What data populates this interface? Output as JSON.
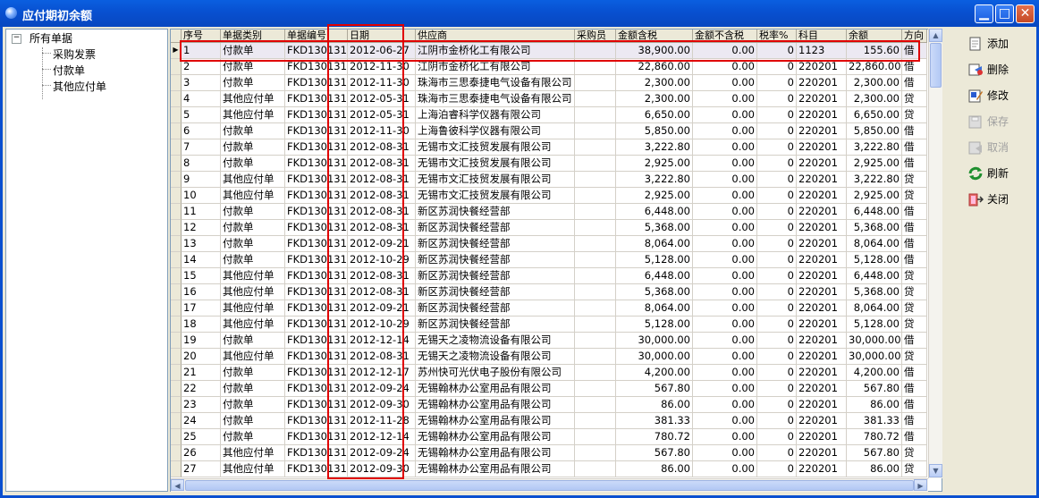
{
  "window": {
    "title": "应付期初余额"
  },
  "tree": {
    "root": "所有单据",
    "children": [
      "采购发票",
      "付款单",
      "其他应付单"
    ]
  },
  "table": {
    "columns": [
      "序号",
      "单据类别",
      "单据编号",
      "日期",
      "供应商",
      "采购员",
      "金额含税",
      "金额不含税",
      "税率%",
      "科目",
      "余额",
      "方向"
    ],
    "rows": [
      [
        "1",
        "付款单",
        "FKD130131",
        "2012-06-27",
        "江阴市金桥化工有限公司",
        "",
        "38,900.00",
        "0.00",
        "0",
        "1123",
        "155.60",
        "借"
      ],
      [
        "2",
        "付款单",
        "FKD130131",
        "2012-11-30",
        "江阴市金桥化工有限公司",
        "",
        "22,860.00",
        "0.00",
        "0",
        "220201",
        "22,860.00",
        "借"
      ],
      [
        "3",
        "付款单",
        "FKD130131",
        "2012-11-30",
        "珠海市三思泰捷电气设备有限公司",
        "",
        "2,300.00",
        "0.00",
        "0",
        "220201",
        "2,300.00",
        "借"
      ],
      [
        "4",
        "其他应付单",
        "FKD130131",
        "2012-05-31",
        "珠海市三思泰捷电气设备有限公司",
        "",
        "2,300.00",
        "0.00",
        "0",
        "220201",
        "2,300.00",
        "贷"
      ],
      [
        "5",
        "其他应付单",
        "FKD130131",
        "2012-05-31",
        "上海泊睿科学仪器有限公司",
        "",
        "6,650.00",
        "0.00",
        "0",
        "220201",
        "6,650.00",
        "贷"
      ],
      [
        "6",
        "付款单",
        "FKD130131",
        "2012-11-30",
        "上海鲁彼科学仪器有限公司",
        "",
        "5,850.00",
        "0.00",
        "0",
        "220201",
        "5,850.00",
        "借"
      ],
      [
        "7",
        "付款单",
        "FKD130131",
        "2012-08-31",
        "无锡市文汇技贸发展有限公司",
        "",
        "3,222.80",
        "0.00",
        "0",
        "220201",
        "3,222.80",
        "借"
      ],
      [
        "8",
        "付款单",
        "FKD130131",
        "2012-08-31",
        "无锡市文汇技贸发展有限公司",
        "",
        "2,925.00",
        "0.00",
        "0",
        "220201",
        "2,925.00",
        "借"
      ],
      [
        "9",
        "其他应付单",
        "FKD130131",
        "2012-08-31",
        "无锡市文汇技贸发展有限公司",
        "",
        "3,222.80",
        "0.00",
        "0",
        "220201",
        "3,222.80",
        "贷"
      ],
      [
        "10",
        "其他应付单",
        "FKD130131",
        "2012-08-31",
        "无锡市文汇技贸发展有限公司",
        "",
        "2,925.00",
        "0.00",
        "0",
        "220201",
        "2,925.00",
        "贷"
      ],
      [
        "11",
        "付款单",
        "FKD130131",
        "2012-08-31",
        "新区苏润快餐经营部",
        "",
        "6,448.00",
        "0.00",
        "0",
        "220201",
        "6,448.00",
        "借"
      ],
      [
        "12",
        "付款单",
        "FKD130131",
        "2012-08-31",
        "新区苏润快餐经营部",
        "",
        "5,368.00",
        "0.00",
        "0",
        "220201",
        "5,368.00",
        "借"
      ],
      [
        "13",
        "付款单",
        "FKD130131",
        "2012-09-21",
        "新区苏润快餐经营部",
        "",
        "8,064.00",
        "0.00",
        "0",
        "220201",
        "8,064.00",
        "借"
      ],
      [
        "14",
        "付款单",
        "FKD130131",
        "2012-10-29",
        "新区苏润快餐经营部",
        "",
        "5,128.00",
        "0.00",
        "0",
        "220201",
        "5,128.00",
        "借"
      ],
      [
        "15",
        "其他应付单",
        "FKD130131",
        "2012-08-31",
        "新区苏润快餐经营部",
        "",
        "6,448.00",
        "0.00",
        "0",
        "220201",
        "6,448.00",
        "贷"
      ],
      [
        "16",
        "其他应付单",
        "FKD130131",
        "2012-08-31",
        "新区苏润快餐经营部",
        "",
        "5,368.00",
        "0.00",
        "0",
        "220201",
        "5,368.00",
        "贷"
      ],
      [
        "17",
        "其他应付单",
        "FKD130131",
        "2012-09-21",
        "新区苏润快餐经营部",
        "",
        "8,064.00",
        "0.00",
        "0",
        "220201",
        "8,064.00",
        "贷"
      ],
      [
        "18",
        "其他应付单",
        "FKD130131",
        "2012-10-29",
        "新区苏润快餐经营部",
        "",
        "5,128.00",
        "0.00",
        "0",
        "220201",
        "5,128.00",
        "贷"
      ],
      [
        "19",
        "付款单",
        "FKD130131",
        "2012-12-14",
        "无锡天之凌物流设备有限公司",
        "",
        "30,000.00",
        "0.00",
        "0",
        "220201",
        "30,000.00",
        "借"
      ],
      [
        "20",
        "其他应付单",
        "FKD130131",
        "2012-08-31",
        "无锡天之凌物流设备有限公司",
        "",
        "30,000.00",
        "0.00",
        "0",
        "220201",
        "30,000.00",
        "贷"
      ],
      [
        "21",
        "付款单",
        "FKD130131",
        "2012-12-17",
        "苏州快可光伏电子股份有限公司",
        "",
        "4,200.00",
        "0.00",
        "0",
        "220201",
        "4,200.00",
        "借"
      ],
      [
        "22",
        "付款单",
        "FKD130131",
        "2012-09-24",
        "无锡翰林办公室用品有限公司",
        "",
        "567.80",
        "0.00",
        "0",
        "220201",
        "567.80",
        "借"
      ],
      [
        "23",
        "付款单",
        "FKD130131",
        "2012-09-30",
        "无锡翰林办公室用品有限公司",
        "",
        "86.00",
        "0.00",
        "0",
        "220201",
        "86.00",
        "借"
      ],
      [
        "24",
        "付款单",
        "FKD130131",
        "2012-11-28",
        "无锡翰林办公室用品有限公司",
        "",
        "381.33",
        "0.00",
        "0",
        "220201",
        "381.33",
        "借"
      ],
      [
        "25",
        "付款单",
        "FKD130131",
        "2012-12-14",
        "无锡翰林办公室用品有限公司",
        "",
        "780.72",
        "0.00",
        "0",
        "220201",
        "780.72",
        "借"
      ],
      [
        "26",
        "其他应付单",
        "FKD130131",
        "2012-09-24",
        "无锡翰林办公室用品有限公司",
        "",
        "567.80",
        "0.00",
        "0",
        "220201",
        "567.80",
        "贷"
      ],
      [
        "27",
        "其他应付单",
        "FKD130131",
        "2012-09-30",
        "无锡翰林办公室用品有限公司",
        "",
        "86.00",
        "0.00",
        "0",
        "220201",
        "86.00",
        "贷"
      ]
    ],
    "row_indicator": "▶"
  },
  "toolbar": {
    "add": "添加",
    "delete": "删除",
    "edit": "修改",
    "save": "保存",
    "cancel": "取消",
    "refresh": "刷新",
    "close": "关闭"
  },
  "colors": {
    "titlebar": "#0A5FE0",
    "highlight": "#E00000"
  }
}
